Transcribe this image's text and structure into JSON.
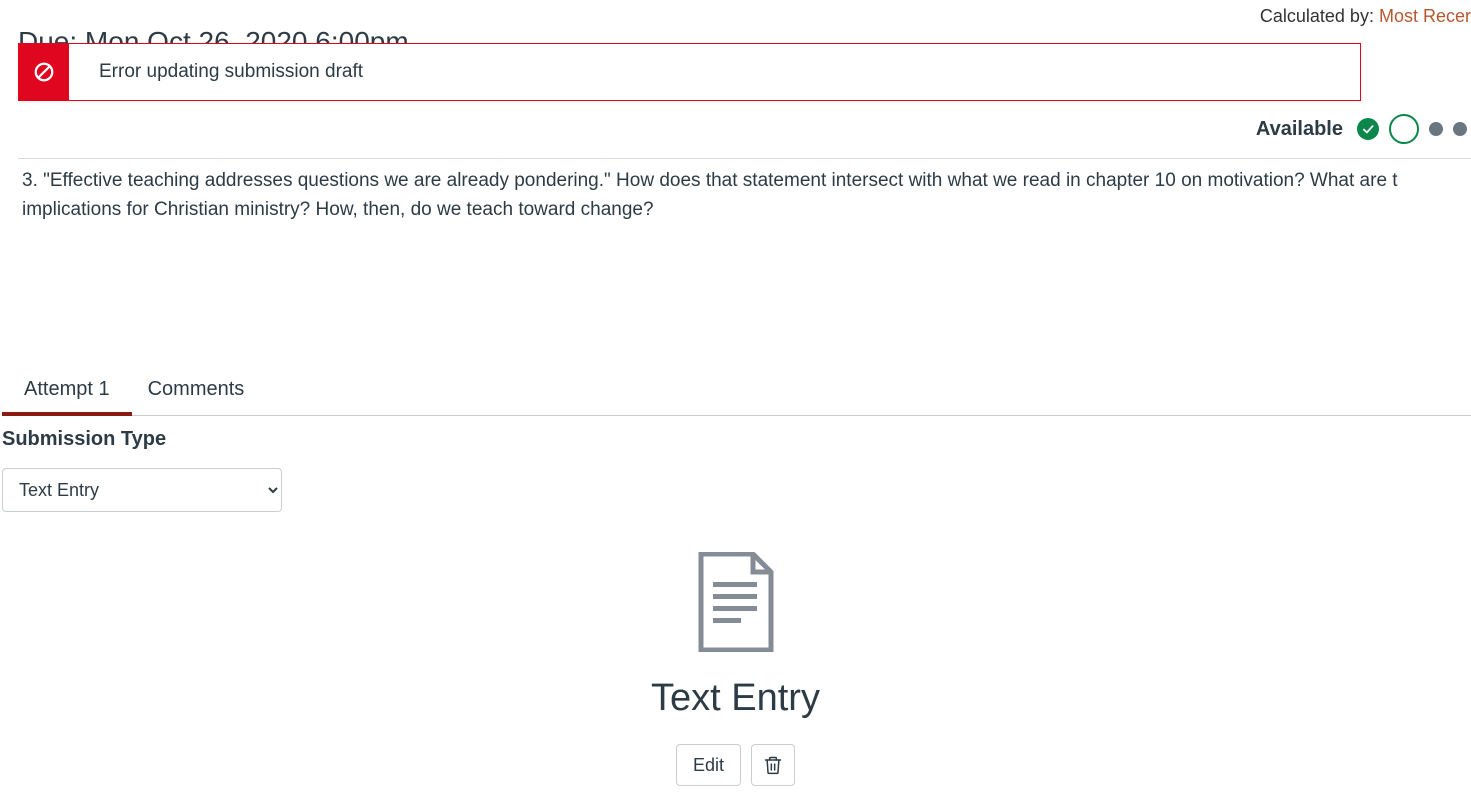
{
  "header": {
    "calculated_by_label": "Calculated by:",
    "calculated_by_value": "Most Recer",
    "due_text": "Due: Mon Oct 26, 2020 6:00pm"
  },
  "alert": {
    "message": "Error updating submission draft"
  },
  "status": {
    "label": "Available"
  },
  "question": {
    "text": "3. \"Effective teaching addresses questions we are already pondering.\" How does that statement intersect with what we read in chapter 10 on motivation? What are t implications for Christian ministry? How, then, do we teach toward change?"
  },
  "tabs": {
    "attempt": "Attempt 1",
    "comments": "Comments"
  },
  "submission": {
    "type_label": "Submission Type",
    "type_value": "Text Entry"
  },
  "entry": {
    "title": "Text Entry",
    "edit_label": "Edit"
  }
}
